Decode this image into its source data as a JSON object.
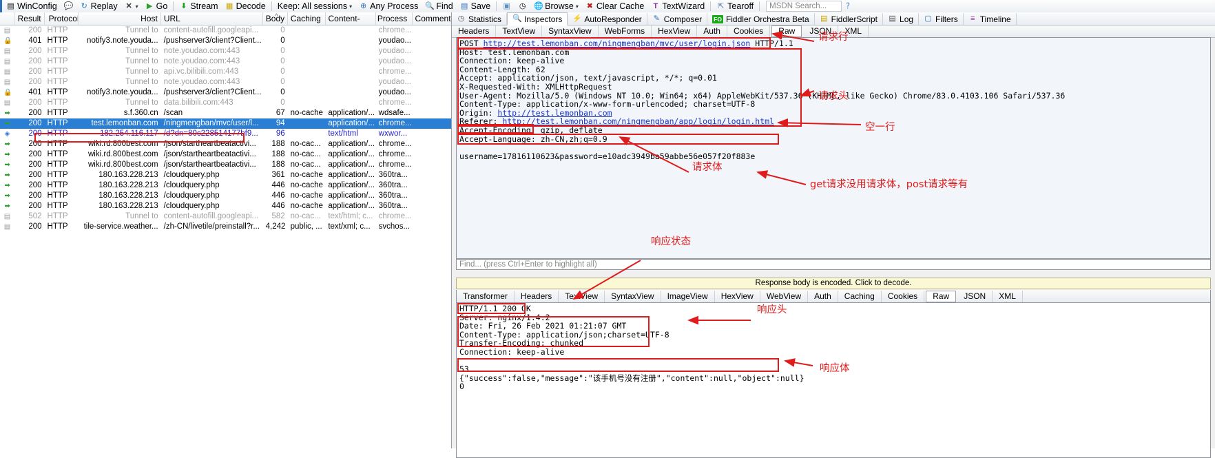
{
  "toolbar": {
    "items": [
      {
        "icon": "winconfig-icon",
        "label": "WinConfig"
      },
      {
        "icon": "comment-icon",
        "label": ""
      },
      {
        "icon": "replay-icon",
        "label": "Replay"
      },
      {
        "icon": "remove-icon",
        "label": ""
      },
      {
        "icon": "go-icon",
        "label": "Go"
      },
      {
        "icon": "stream-icon",
        "label": "Stream"
      },
      {
        "icon": "decode-icon",
        "label": "Decode"
      },
      {
        "icon": "keep-icon",
        "label": "Keep: All sessions"
      },
      {
        "icon": "any-process-icon",
        "label": "Any Process"
      },
      {
        "icon": "find-icon",
        "label": "Find"
      },
      {
        "icon": "save-icon",
        "label": "Save"
      },
      {
        "icon": "camera-icon",
        "label": ""
      },
      {
        "icon": "timer-icon",
        "label": ""
      },
      {
        "icon": "browse-icon",
        "label": "Browse"
      },
      {
        "icon": "clear-cache-icon",
        "label": "Clear Cache"
      },
      {
        "icon": "textwizard-icon",
        "label": "TextWizard"
      },
      {
        "icon": "tearoff-icon",
        "label": "Tearoff"
      }
    ],
    "msdn_placeholder": "MSDN Search...",
    "help_icon": "help-icon"
  },
  "sessions": {
    "columns": [
      "",
      "Result",
      "Protocol",
      "Host",
      "URL",
      "Body",
      "Caching",
      "Content-Type",
      "Process",
      "Comments"
    ],
    "rows": [
      {
        "icon": "doc-icon",
        "style": "grey",
        "id": "4...",
        "result": "200",
        "protocol": "HTTP",
        "host": "Tunnel to",
        "url": "content-autofill.googleapi...",
        "body": "0",
        "caching": "",
        "ctype": "",
        "process": "chrome...",
        "comments": ""
      },
      {
        "icon": "lock-icon",
        "style": "gold",
        "id": "4...",
        "result": "401",
        "protocol": "HTTP",
        "host": "notify3.note.youda...",
        "url": "/pushserver3/client?Client...",
        "body": "0",
        "caching": "",
        "ctype": "",
        "process": "youdao...",
        "comments": ""
      },
      {
        "icon": "doc-icon",
        "style": "grey",
        "id": "4...",
        "result": "200",
        "protocol": "HTTP",
        "host": "Tunnel to",
        "url": "note.youdao.com:443",
        "body": "0",
        "caching": "",
        "ctype": "",
        "process": "youdao...",
        "comments": ""
      },
      {
        "icon": "doc-icon",
        "style": "grey",
        "id": "4...",
        "result": "200",
        "protocol": "HTTP",
        "host": "Tunnel to",
        "url": "note.youdao.com:443",
        "body": "0",
        "caching": "",
        "ctype": "",
        "process": "youdao...",
        "comments": ""
      },
      {
        "icon": "doc-icon",
        "style": "grey",
        "id": "4...",
        "result": "200",
        "protocol": "HTTP",
        "host": "Tunnel to",
        "url": "api.vc.bilibili.com:443",
        "body": "0",
        "caching": "",
        "ctype": "",
        "process": "chrome...",
        "comments": ""
      },
      {
        "icon": "doc-icon",
        "style": "grey",
        "id": "4...",
        "result": "200",
        "protocol": "HTTP",
        "host": "Tunnel to",
        "url": "note.youdao.com:443",
        "body": "0",
        "caching": "",
        "ctype": "",
        "process": "youdao...",
        "comments": ""
      },
      {
        "icon": "lock-icon",
        "style": "gold",
        "id": "4...",
        "result": "401",
        "protocol": "HTTP",
        "host": "notify3.note.youda...",
        "url": "/pushserver3/client?Client...",
        "body": "0",
        "caching": "",
        "ctype": "",
        "process": "youdao...",
        "comments": ""
      },
      {
        "icon": "doc-icon",
        "style": "grey",
        "id": "4...",
        "result": "200",
        "protocol": "HTTP",
        "host": "Tunnel to",
        "url": "data.bilibili.com:443",
        "body": "0",
        "caching": "",
        "ctype": "",
        "process": "chrome...",
        "comments": ""
      },
      {
        "icon": "green-arrow-icon",
        "style": "normal",
        "id": "4...",
        "result": "200",
        "protocol": "HTTP",
        "host": "s.f.360.cn",
        "url": "/scan",
        "body": "67",
        "caching": "no-cache",
        "ctype": "application/...",
        "process": "wdsafe...",
        "comments": ""
      },
      {
        "icon": "green-arrow-icon",
        "style": "selected",
        "id": "4...",
        "result": "200",
        "protocol": "HTTP",
        "host": "test.lemonban.com",
        "url": "/ningmengban/mvc/user/l...",
        "body": "94",
        "caching": "",
        "ctype": "application/...",
        "process": "chrome...",
        "comments": ""
      },
      {
        "icon": "blue-arrow-icon",
        "style": "blue",
        "id": "4...",
        "result": "200",
        "protocol": "HTTP",
        "host": "182.254.116.117",
        "url": "/d?dn=80c228514177bf9...",
        "body": "96",
        "caching": "",
        "ctype": "text/html",
        "process": "wxwor...",
        "comments": ""
      },
      {
        "icon": "green-arrow-icon",
        "style": "normal",
        "id": "4...",
        "result": "200",
        "protocol": "HTTP",
        "host": "wiki.rd.800best.com",
        "url": "/json/startheartbeatactivi...",
        "body": "188",
        "caching": "no-cac...",
        "ctype": "application/...",
        "process": "chrome...",
        "comments": ""
      },
      {
        "icon": "green-arrow-icon",
        "style": "normal",
        "id": "4...",
        "result": "200",
        "protocol": "HTTP",
        "host": "wiki.rd.800best.com",
        "url": "/json/startheartbeatactivi...",
        "body": "188",
        "caching": "no-cac...",
        "ctype": "application/...",
        "process": "chrome...",
        "comments": ""
      },
      {
        "icon": "green-arrow-icon",
        "style": "normal",
        "id": "4...",
        "result": "200",
        "protocol": "HTTP",
        "host": "wiki.rd.800best.com",
        "url": "/json/startheartbeatactivi...",
        "body": "188",
        "caching": "no-cac...",
        "ctype": "application/...",
        "process": "chrome...",
        "comments": ""
      },
      {
        "icon": "green-arrow-icon",
        "style": "normal",
        "id": "4...",
        "result": "200",
        "protocol": "HTTP",
        "host": "180.163.228.213",
        "url": "/cloudquery.php",
        "body": "361",
        "caching": "no-cache",
        "ctype": "application/...",
        "process": "360tra...",
        "comments": ""
      },
      {
        "icon": "green-arrow-icon",
        "style": "normal",
        "id": "4...",
        "result": "200",
        "protocol": "HTTP",
        "host": "180.163.228.213",
        "url": "/cloudquery.php",
        "body": "446",
        "caching": "no-cache",
        "ctype": "application/...",
        "process": "360tra...",
        "comments": ""
      },
      {
        "icon": "green-arrow-icon",
        "style": "normal",
        "id": "4...",
        "result": "200",
        "protocol": "HTTP",
        "host": "180.163.228.213",
        "url": "/cloudquery.php",
        "body": "446",
        "caching": "no-cache",
        "ctype": "application/...",
        "process": "360tra...",
        "comments": ""
      },
      {
        "icon": "green-arrow-icon",
        "style": "normal",
        "id": "4...",
        "result": "200",
        "protocol": "HTTP",
        "host": "180.163.228.213",
        "url": "/cloudquery.php",
        "body": "446",
        "caching": "no-cache",
        "ctype": "application/...",
        "process": "360tra...",
        "comments": ""
      },
      {
        "icon": "doc-icon",
        "style": "grey",
        "id": "4...",
        "result": "502",
        "protocol": "HTTP",
        "host": "Tunnel to",
        "url": "content-autofill.googleapi...",
        "body": "582",
        "caching": "no-cac...",
        "ctype": "text/html; c...",
        "process": "chrome...",
        "comments": ""
      },
      {
        "icon": "doc-icon",
        "style": "normal",
        "id": "4...",
        "result": "200",
        "protocol": "HTTP",
        "host": "tile-service.weather...",
        "url": "/zh-CN/livetile/preinstall?r...",
        "body": "4,242",
        "caching": "public, ...",
        "ctype": "text/xml; c...",
        "process": "svchos...",
        "comments": ""
      }
    ]
  },
  "right_pane": {
    "main_tabs": [
      {
        "label": "Statistics",
        "icon": "statistics-icon",
        "active": false
      },
      {
        "label": "Inspectors",
        "icon": "inspectors-icon",
        "active": true
      },
      {
        "label": "AutoResponder",
        "icon": "autoresponder-icon",
        "active": false
      },
      {
        "label": "Composer",
        "icon": "composer-icon",
        "active": false
      },
      {
        "label": "Fiddler Orchestra Beta",
        "icon": "fiddler-orchestra-icon",
        "active": false
      },
      {
        "label": "FiddlerScript",
        "icon": "fiddlerscript-icon",
        "active": false
      },
      {
        "label": "Log",
        "icon": "log-icon",
        "active": false
      },
      {
        "label": "Filters",
        "icon": "filters-icon",
        "active": false
      },
      {
        "label": "Timeline",
        "icon": "timeline-icon",
        "active": false
      }
    ],
    "request_tabs": [
      {
        "label": "Headers",
        "active": false
      },
      {
        "label": "TextView",
        "active": false
      },
      {
        "label": "SyntaxView",
        "active": false
      },
      {
        "label": "WebForms",
        "active": false
      },
      {
        "label": "HexView",
        "active": false
      },
      {
        "label": "Auth",
        "active": false
      },
      {
        "label": "Cookies",
        "active": false
      },
      {
        "label": "Raw",
        "active": true
      },
      {
        "label": "JSON",
        "active": false
      },
      {
        "label": "XML",
        "active": false
      }
    ],
    "request": {
      "request_line_method": "POST ",
      "request_line_url": "http://test.lemonban.com/ningmengban/mvc/user/login.json",
      "request_line_version": " HTTP/1.1",
      "host_line": "Host: test.lemonban.com",
      "headers": [
        "Connection: keep-alive",
        "Content-Length: 62",
        "Accept: application/json, text/javascript, */*; q=0.01",
        "X-Requested-With: XMLHttpRequest",
        "User-Agent: Mozilla/5.0 (Windows NT 10.0; Win64; x64) AppleWebKit/537.36 (KHTML, like Gecko) Chrome/83.0.4103.106 Safari/537.36",
        "Content-Type: application/x-www-form-urlencoded; charset=UTF-8"
      ],
      "origin_label": "Origin: ",
      "origin_url": "http://test.lemonban.com",
      "referer_label": "Referer: ",
      "referer_url": "http://test.lemonban.com/ningmengban/app/login/login.html",
      "accept_encoding": "Accept-Encoding: gzip, deflate",
      "accept_language": "Accept-Language: zh-CN,zh;q=0.9",
      "blank_line": "",
      "body": "username=17816110623&password=e10adc3949ba59abbe56e057f20f883e"
    },
    "find_placeholder": "Find... (press Ctrl+Enter to highlight all)",
    "response_note": "Response body is encoded. Click to decode.",
    "response_tabs": [
      {
        "label": "Transformer",
        "active": false
      },
      {
        "label": "Headers",
        "active": false
      },
      {
        "label": "TextView",
        "active": false
      },
      {
        "label": "SyntaxView",
        "active": false
      },
      {
        "label": "ImageView",
        "active": false
      },
      {
        "label": "HexView",
        "active": false
      },
      {
        "label": "WebView",
        "active": false
      },
      {
        "label": "Auth",
        "active": false
      },
      {
        "label": "Caching",
        "active": false
      },
      {
        "label": "Cookies",
        "active": false
      },
      {
        "label": "Raw",
        "active": true
      },
      {
        "label": "JSON",
        "active": false
      },
      {
        "label": "XML",
        "active": false
      }
    ],
    "response": {
      "status_line": "HTTP/1.1 200 OK",
      "server": "Server: nginx/1.4.2",
      "headers": [
        "Date: Fri, 26 Feb 2021 01:21:07 GMT",
        "Content-Type: application/json;charset=UTF-8",
        "Transfer-Encoding: chunked",
        "Connection: keep-alive"
      ],
      "chunk_size": "53",
      "body": "{\"success\":false,\"message\":\"该手机号没有注册\",\"content\":null,\"object\":null}",
      "chunk_end": "0"
    }
  },
  "annotations": {
    "accent_color": "#e01b1b",
    "labels": [
      {
        "id": "request-line",
        "text": "请求行"
      },
      {
        "id": "request-headers",
        "text": "请求头"
      },
      {
        "id": "blank-line",
        "text": "空一行"
      },
      {
        "id": "request-body",
        "text": "请求体"
      },
      {
        "id": "get-post-note",
        "text": "get请求没用请求体，post请求等有"
      },
      {
        "id": "response-status",
        "text": "响应状态"
      },
      {
        "id": "response-headers",
        "text": "响应头"
      },
      {
        "id": "response-body",
        "text": "响应体"
      }
    ]
  }
}
